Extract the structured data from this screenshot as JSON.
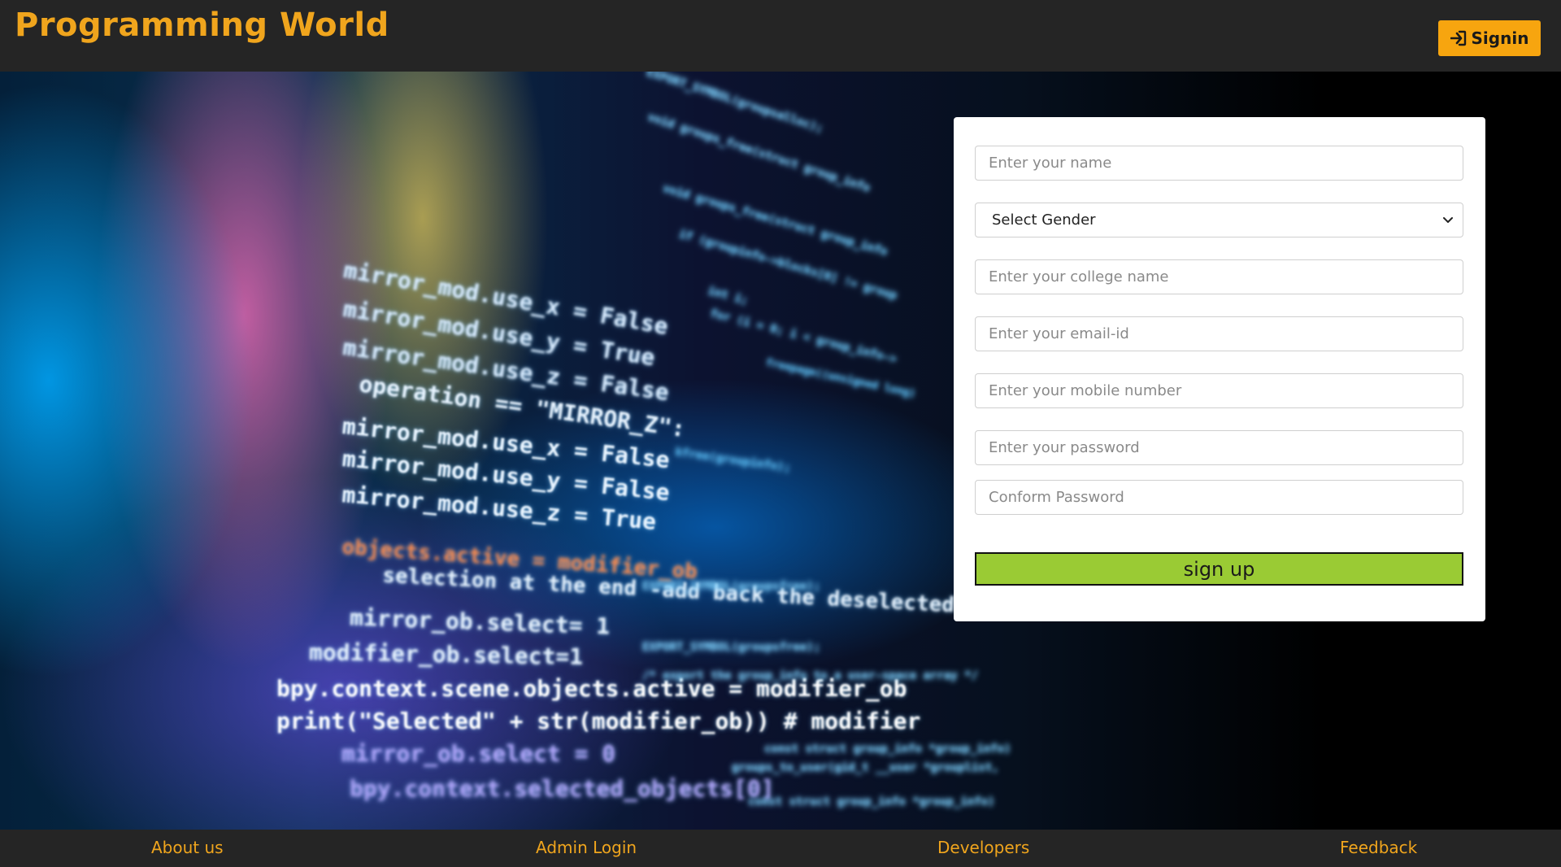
{
  "header": {
    "brand": "Programming World",
    "signin_label": "Signin",
    "signin_icon": "sign-in-icon"
  },
  "background_code": {
    "lines": [
      "EXPORT_SYMBOL(groupsalloc);",
      "void groups_free(struct group_info",
      "if (groupinfo->blocks[0] != group",
      "int i;",
      "for (i = 0; i < group_info->",
      "freepage((unsigned long)",
      "kfree(groupinfo);",
      "mirror_mod.use_x = False",
      "mirror_mod.use_y = True",
      "mirror_mod.use_z = False",
      "operation == \"MIRROR_Z\":",
      "mirror_mod.use_x = False",
      "mirror_mod.use_y = False",
      "mirror_mod.use_z = True",
      "objects.active = modifier_ob",
      "selection at the end -add back the deselected",
      "mirror_ob.select= 1",
      "modifier_ob.select=1",
      "bpy.context.scene.objects.active = modifier_ob",
      "print(\"Selected\" + str(modifier_ob)) # modifier",
      "mirror_ob.select = 0",
      "bpy.context.selected_objects[0]",
      "EXPORT_SYMBOL(groupsfree);",
      "/* export the group_info to a user-space array */",
      "const struct group_info *group_info)",
      "groups_to_user(gid_t __user *grouplist,",
      "const struct group_info *group_info)"
    ]
  },
  "form": {
    "name_placeholder": "Enter your name",
    "gender_selected": "Select Gender",
    "college_placeholder": "Enter your college name",
    "email_placeholder": "Enter your email-id",
    "mobile_placeholder": "Enter your mobile number",
    "password_placeholder": "Enter your password",
    "confirm_placeholder": "Conform Password",
    "submit_label": "sign up"
  },
  "footer": {
    "about": "About us",
    "admin": "Admin Login",
    "developers": "Developers",
    "feedback": "Feedback"
  },
  "colors": {
    "brand": "#f0a51d",
    "signin_bg": "#f7a50f",
    "signup_bg": "#9acb34",
    "bar_bg": "#252525"
  }
}
